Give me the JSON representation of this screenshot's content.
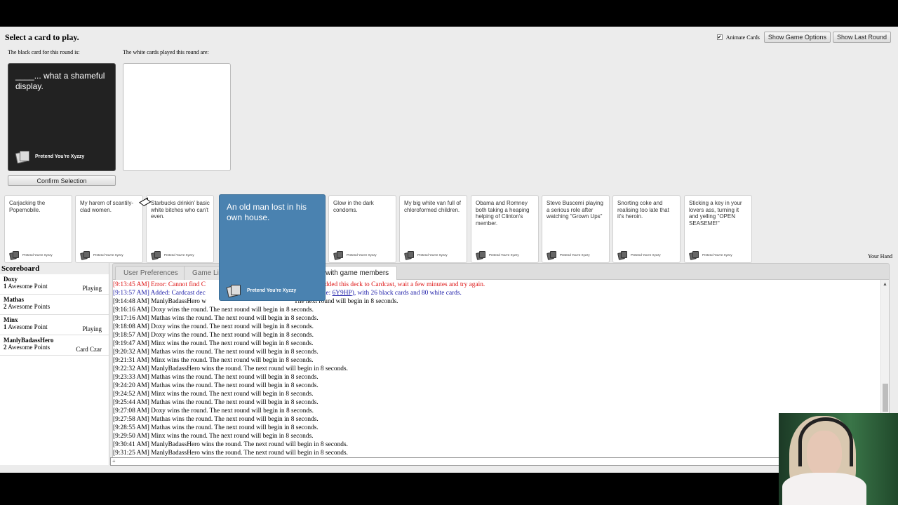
{
  "header": {
    "title": "Select a card to play.",
    "black_card_label": "The black card for this round is:",
    "white_cards_label": "The white cards played this round are:"
  },
  "top_controls": {
    "animate_cards_label": "Animate Cards",
    "animate_cards_checked": true,
    "show_game_options": "Show Game Options",
    "show_last_round": "Show Last Round"
  },
  "black_card": {
    "text": "____... what a shameful display.",
    "logo_text": "Pretend You're Xyzzy"
  },
  "confirm_button": "Confirm Selection",
  "hand": {
    "label": "Your Hand",
    "cards": [
      {
        "text": "Carjacking the Popemobile.",
        "logo": "Pretend You're Xyzzy"
      },
      {
        "text": "My harem of scantily-clad women.",
        "logo": "Pretend You're Xyzzy"
      },
      {
        "text": "Starbucks drinkin' basic white bitches who can't even.",
        "logo": "Pretend You're Xyzzy"
      },
      {
        "text": "Glow in the dark condoms.",
        "logo": "Pretend You're Xyzzy"
      },
      {
        "text": "My big white van full of chloroformed children.",
        "logo": "Pretend You're Xyzzy"
      },
      {
        "text": "Obama and Romney both taking a heaping helping of Clinton's member.",
        "logo": "Pretend You're Xyzzy"
      },
      {
        "text": "Steve Buscemi playing a serious role after watching \"Grown Ups\"",
        "logo": "Pretend You're Xyzzy"
      },
      {
        "text": "Snorting coke and realising too late that it's heroin.",
        "logo": "Pretend You're Xyzzy"
      },
      {
        "text": "Sticking a key in your lovers ass, turning it and yelling \"OPEN SEASEME!\"",
        "logo": "Pretend You're Xyzzy"
      }
    ],
    "selected_card": {
      "text": "An old man lost in his own house.",
      "logo": "Pretend You're Xyzzy"
    }
  },
  "scoreboard": {
    "title": "Scoreboard",
    "players": [
      {
        "name": "Doxy",
        "points": "1",
        "points_label": "Awesome Point",
        "status": "Playing"
      },
      {
        "name": "Mathas",
        "points": "2",
        "points_label": "Awesome Points",
        "status": ""
      },
      {
        "name": "Minx",
        "points": "1",
        "points_label": "Awesome Point",
        "status": "Playing"
      },
      {
        "name": "ManlyBadassHero",
        "points": "2",
        "points_label": "Awesome Points",
        "status": "Card Czar"
      }
    ]
  },
  "tabs": [
    {
      "label": "User Preferences",
      "active": false
    },
    {
      "label": "Game Li",
      "active": false
    },
    {
      "label": "at with game members",
      "active": true
    }
  ],
  "log": {
    "error_line_a": "[9:13:45 AM] Error: Cannot find C",
    "error_line_b": "ast added this deck to Cardcast, wait a few minutes and try again.",
    "info_line_a": "[9:13:57 AM] Added: Cardcast dec",
    "info_line_b": "' (code: ",
    "info_code": "6Y9HP",
    "info_line_c": "), with 26 black cards and 80 white cards.",
    "partial_line_a": "[9:14:48 AM] ManlyBadassHero w",
    "partial_line_b": "The next round will begin in 8 seconds.",
    "lines": [
      "[9:16:16 AM] Doxy wins the round. The next round will begin in 8 seconds.",
      "[9:17:16 AM] Mathas wins the round. The next round will begin in 8 seconds.",
      "[9:18:08 AM] Doxy wins the round. The next round will begin in 8 seconds.",
      "[9:18:57 AM] Doxy wins the round. The next round will begin in 8 seconds.",
      "[9:19:47 AM] Minx wins the round. The next round will begin in 8 seconds.",
      "[9:20:32 AM] Mathas wins the round. The next round will begin in 8 seconds.",
      "[9:21:31 AM] Minx wins the round. The next round will begin in 8 seconds.",
      "[9:22:32 AM] ManlyBadassHero wins the round. The next round will begin in 8 seconds.",
      "[9:23:33 AM] Mathas wins the round. The next round will begin in 8 seconds.",
      "[9:24:20 AM] Mathas wins the round. The next round will begin in 8 seconds.",
      "[9:24:52 AM] Minx wins the round. The next round will begin in 8 seconds.",
      "[9:25:44 AM] Mathas wins the round. The next round will begin in 8 seconds.",
      "[9:27:08 AM] Doxy wins the round. The next round will begin in 8 seconds.",
      "[9:27:58 AM] Mathas wins the round. The next round will begin in 8 seconds.",
      "[9:28:55 AM] Mathas wins the round. The next round will begin in 8 seconds.",
      "[9:29:50 AM] Minx wins the round. The next round will begin in 8 seconds.",
      "[9:30:41 AM] ManlyBadassHero wins the round. The next round will begin in 8 seconds.",
      "[9:31:25 AM] ManlyBadassHero wins the round. The next round will begin in 8 seconds."
    ]
  },
  "chat_input": {
    "value": "+"
  },
  "colors": {
    "selected_card": "#4a82b0",
    "error_text": "#d11111",
    "info_text": "#2222aa",
    "black_card": "#222222"
  }
}
